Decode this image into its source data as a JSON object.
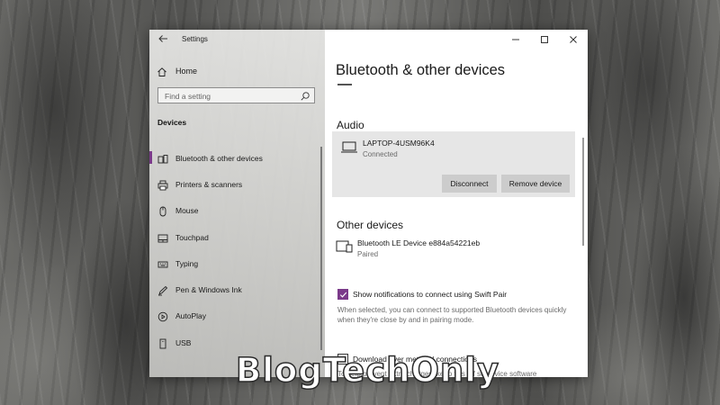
{
  "window": {
    "title": "Settings"
  },
  "nav": {
    "home_label": "Home",
    "search_placeholder": "Find a setting",
    "section_label": "Devices",
    "items": [
      {
        "label": "Bluetooth & other devices",
        "icon": "bluetooth-devices-icon",
        "selected": true
      },
      {
        "label": "Printers & scanners",
        "icon": "printer-icon",
        "selected": false
      },
      {
        "label": "Mouse",
        "icon": "mouse-icon",
        "selected": false
      },
      {
        "label": "Touchpad",
        "icon": "touchpad-icon",
        "selected": false
      },
      {
        "label": "Typing",
        "icon": "keyboard-icon",
        "selected": false
      },
      {
        "label": "Pen & Windows Ink",
        "icon": "pen-icon",
        "selected": false
      },
      {
        "label": "AutoPlay",
        "icon": "autoplay-icon",
        "selected": false
      },
      {
        "label": "USB",
        "icon": "usb-icon",
        "selected": false
      }
    ]
  },
  "content": {
    "page_title": "Bluetooth & other devices",
    "audio": {
      "heading": "Audio",
      "device_name": "LAPTOP-4USM96K4",
      "device_status": "Connected",
      "disconnect_label": "Disconnect",
      "remove_label": "Remove device"
    },
    "other": {
      "heading": "Other devices",
      "device_name": "Bluetooth LE Device e884a54221eb",
      "device_status": "Paired"
    },
    "swift_pair": {
      "label": "Show notifications to connect using Swift Pair",
      "checked": true,
      "description": "When selected, you can connect to supported Bluetooth devices quickly when they're close by and in pairing mode."
    },
    "metered": {
      "label": "Download over metered connections",
      "checked": false,
      "description": "To help prevent extra charges, keep this off so device software"
    }
  },
  "watermark": "BlogTechOnly",
  "colors": {
    "accent": "#7b3a8a",
    "card": "#e6e6e6",
    "button": "#cccccc"
  }
}
